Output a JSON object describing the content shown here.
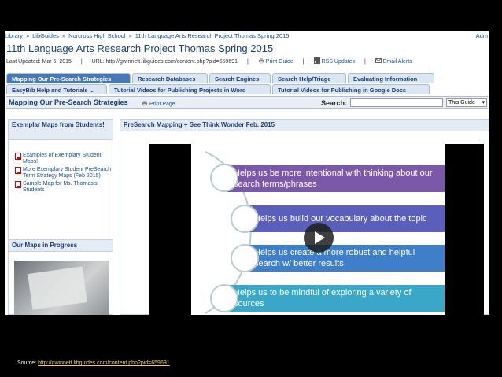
{
  "breadcrumb": {
    "items": [
      "Library",
      "LibGuides",
      "Norcross High School",
      "11th Language Arts Research Project Thomas Spring 2015"
    ],
    "separator": "»",
    "admin": "Adm"
  },
  "guide": {
    "title": "11th Language Arts Research Project Thomas Spring 2015",
    "last_updated": "Last Updated: Mar 5, 2015",
    "url": "URL: http://gwinnett.libguides.com/content.php?pid=659691",
    "print_guide": "Print Guide",
    "rss": "RSS Updates",
    "email": "Email Alerts"
  },
  "tabs_row1": [
    "Mapping Our Pre-Search Strategies",
    "Research Databases",
    "Search Engines",
    "Search Help/Triage",
    "Evaluating Information"
  ],
  "tabs_row2": [
    "EasyBib Help and Tutorials",
    "Tutorial Videos for Publishing Projects in Word",
    "Tutorial Videos for Publishing in Google Docs"
  ],
  "tabs_row2_caret": "⌄",
  "pagebar": {
    "page_title": "Mapping Our Pre-Search Strategies",
    "print_page": "Print Page",
    "search_label": "Search:",
    "search_value": "",
    "scope_value": "This Guide",
    "scope_caret": "▾"
  },
  "left_box1": {
    "title": "Exemplar Maps from Students!",
    "links": [
      "Examples of Exemplary Student Maps!",
      "More Exemplary Student PreSearch Term Strategy Maps (Feb 2015)",
      "Sample Map for Ms. Thomas's Students"
    ]
  },
  "left_box2": {
    "title": "Our Maps in Progress"
  },
  "main_box": {
    "title": "PreSearch Mapping + See Think Wonder Feb. 2015"
  },
  "video_slide": {
    "items": [
      {
        "text": "Helps us be more intentional with thinking about our search terms/phrases",
        "color": "#7b58a8"
      },
      {
        "text": "Helps us build our vocabulary about the topic",
        "color": "#5b5fbb"
      },
      {
        "text": "Helps us create a more robust and helpful search w/ better results",
        "color": "#3f7fc9"
      },
      {
        "text": "Helps us to be mindful of exploring a variety of sources",
        "color": "#3aa6c8"
      }
    ]
  },
  "source": {
    "label": "Source:",
    "link": "http://gwinnett.libguides.com/content.php?pid=659691"
  }
}
